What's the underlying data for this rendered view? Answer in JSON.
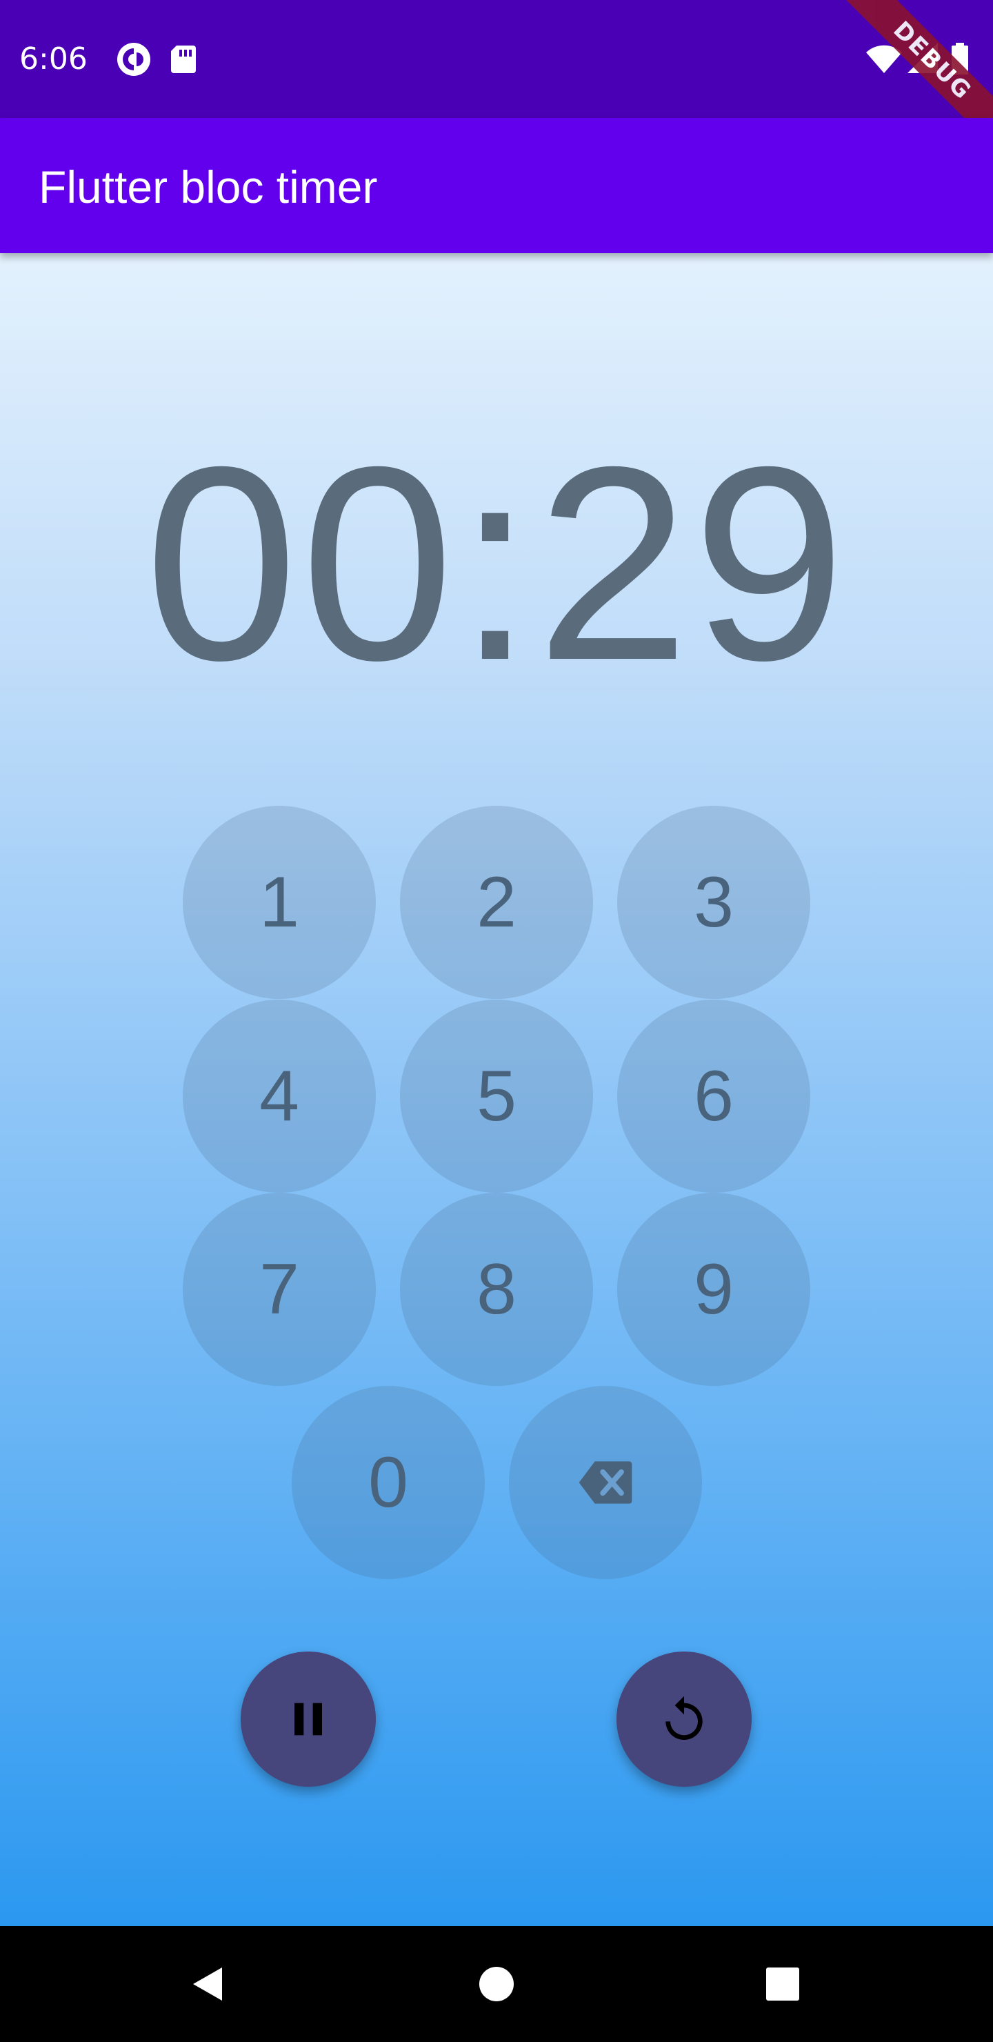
{
  "status_bar": {
    "time": "6:06",
    "icons": [
      "pocket-casts-icon",
      "sd-card-icon",
      "wifi-icon",
      "signal-icon",
      "battery-icon"
    ],
    "debug_label": "DEBUG"
  },
  "app_bar": {
    "title": "Flutter bloc timer"
  },
  "timer": {
    "display": "00:29"
  },
  "keypad": {
    "keys": [
      "1",
      "2",
      "3",
      "4",
      "5",
      "6",
      "7",
      "8",
      "9",
      "0"
    ],
    "backspace_icon": "backspace-icon"
  },
  "actions": {
    "pause_icon": "pause-icon",
    "reset_icon": "replay-icon"
  },
  "nav_bar": {
    "icons": [
      "back-icon",
      "home-icon",
      "recents-icon"
    ]
  },
  "colors": {
    "status_bar": "#4a00b4",
    "app_bar": "#6200ee",
    "fab": "#46467c",
    "timer_text": "#5a6b7b"
  }
}
